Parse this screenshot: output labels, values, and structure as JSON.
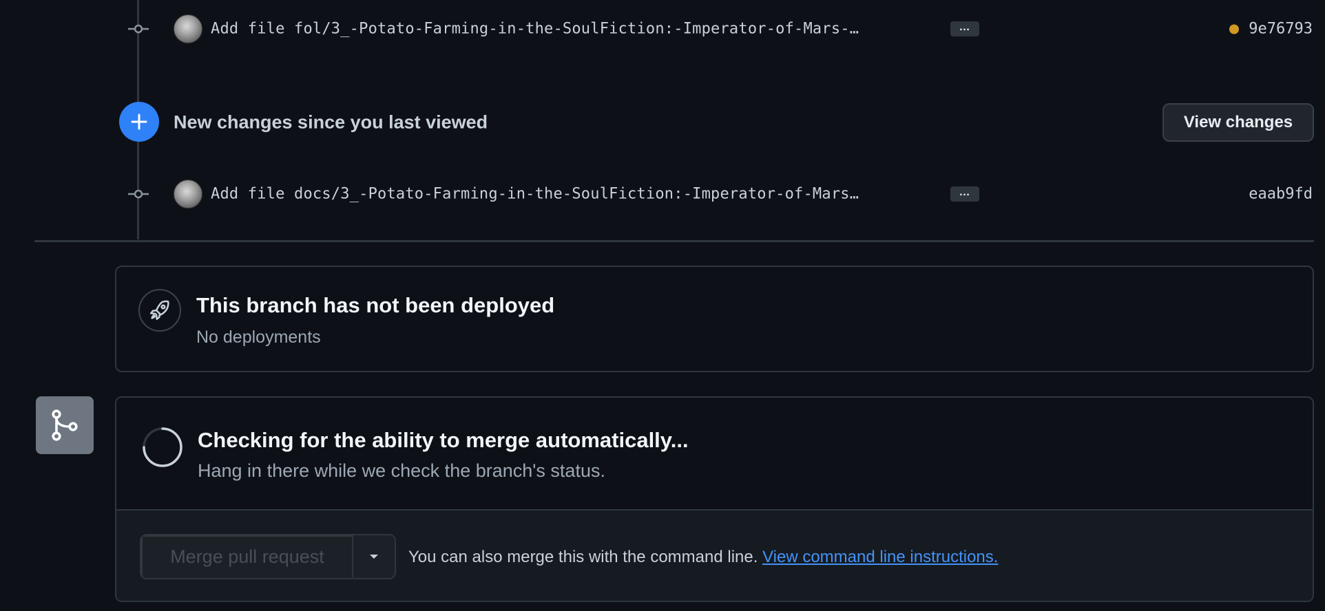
{
  "commits": [
    {
      "message": "Add file fol/3_-Potato-Farming-in-the-SoulFiction:-Imperator-of-Mars-…",
      "sha": "9e76793",
      "status": "pending",
      "status_color": "#d29922",
      "more_label": "…"
    },
    {
      "message": "Add file docs/3_-Potato-Farming-in-the-SoulFiction:-Imperator-of-Mars…",
      "sha": "eaab9fd",
      "more_label": "…"
    }
  ],
  "new_changes": {
    "text": "New changes since you last viewed",
    "button_label": "View changes",
    "icon": "plus-icon"
  },
  "deployment": {
    "title": "This branch has not been deployed",
    "subtitle": "No deployments",
    "icon": "rocket-icon"
  },
  "merge": {
    "title": "Checking for the ability to merge automatically...",
    "subtitle": "Hang in there while we check the branch's status.",
    "button_label": "Merge pull request",
    "hint_text": "You can also merge this with the command line.",
    "hint_link": "View command line instructions.",
    "icon": "git-merge-icon"
  },
  "colors": {
    "background": "#0d1117",
    "accent_blue": "#2f81f7",
    "link": "#4493f8",
    "pending": "#d29922"
  }
}
